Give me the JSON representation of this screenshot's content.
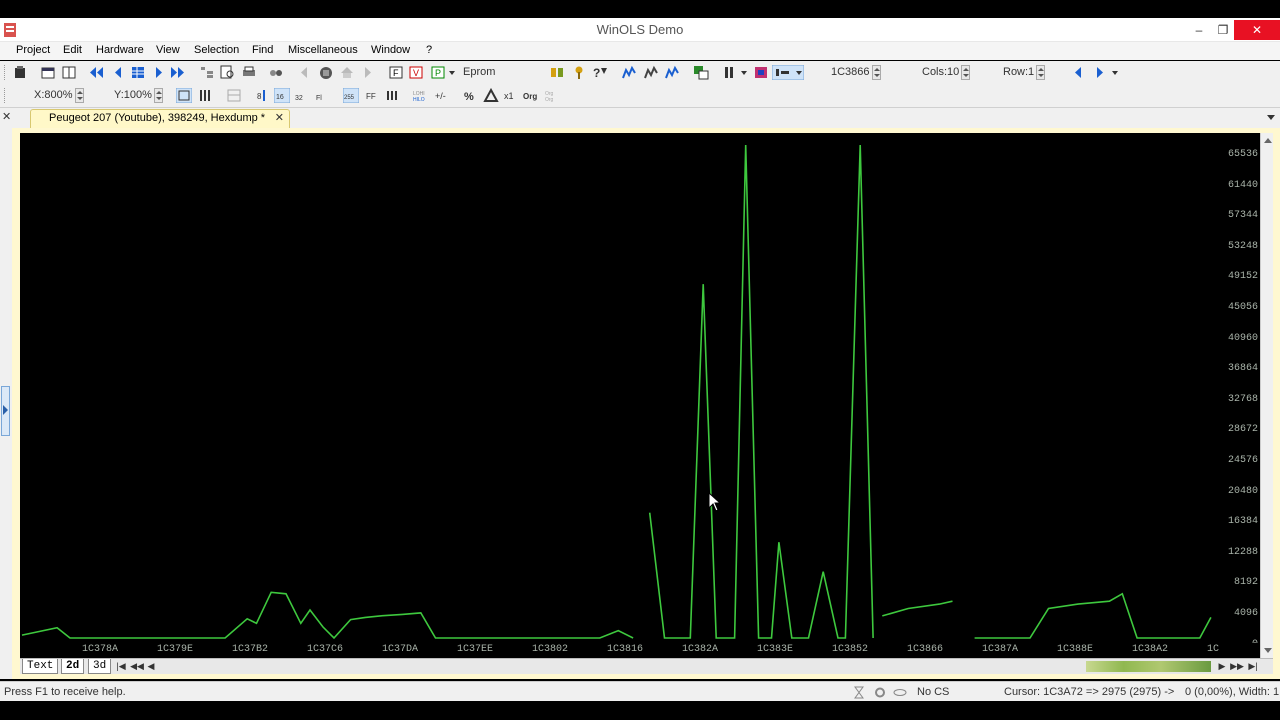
{
  "window": {
    "title": "WinOLS Demo",
    "minimize_glyph": "–",
    "restore_glyph": "❐",
    "close_glyph": "✕"
  },
  "menu": [
    "Project",
    "Edit",
    "Hardware",
    "View",
    "Selection",
    "Find",
    "Miscellaneous",
    "Window",
    "?"
  ],
  "toolbar": {
    "eprom_combo": "Eprom",
    "address": "1C3866",
    "cols": "Cols:10",
    "row": "Row:1",
    "x_zoom": "X:800%",
    "y_zoom": "Y:100%",
    "btn_255": "255",
    "btn_ff": "FF",
    "btn_percent": "%",
    "btn_x1": "x1",
    "btn_org": "Org"
  },
  "tab": {
    "label": "Peugeot 207 (Youtube), 398249, Hexdump *",
    "close_glyph": "✕",
    "left_close_glyph": "✕"
  },
  "chart_data": {
    "type": "line",
    "y_ticks": [
      "65536",
      "61440",
      "57344",
      "53248",
      "49152",
      "45056",
      "40960",
      "36864",
      "32768",
      "28672",
      "24576",
      "20480",
      "16384",
      "12288",
      "8192",
      "4096",
      "0"
    ],
    "x_ticks": [
      "1C378A",
      "1C379E",
      "1C37B2",
      "1C37C6",
      "1C37DA",
      "1C37EE",
      "1C3802",
      "1C3816",
      "1C382A",
      "1C383E",
      "1C3852",
      "1C3866",
      "1C387A",
      "1C388E",
      "1C38A2",
      "1C"
    ],
    "ylim": [
      0,
      65536
    ],
    "grid": false,
    "series_color": "#3ec83e",
    "segments": [
      [
        [
          0,
          400
        ],
        [
          1.9,
          1400
        ],
        [
          2.6,
          0
        ],
        [
          10.2,
          0
        ],
        [
          11.0,
          0
        ],
        [
          12.2,
          2600
        ],
        [
          12.7,
          2000
        ],
        [
          13.5,
          6200
        ],
        [
          14.3,
          6000
        ],
        [
          15.1,
          2000
        ],
        [
          15.6,
          3800
        ],
        [
          16.3,
          1500
        ],
        [
          16.9,
          0
        ],
        [
          17.8,
          2500
        ],
        [
          18.6,
          2800
        ],
        [
          19.4,
          3000
        ],
        [
          20.6,
          3200
        ],
        [
          21.6,
          3400
        ],
        [
          22.4,
          0
        ],
        [
          31.3,
          0
        ],
        [
          32.3,
          1000
        ],
        [
          33.1,
          0
        ]
      ],
      [
        [
          34.0,
          17000
        ],
        [
          34.8,
          0
        ],
        [
          36.2,
          0
        ],
        [
          36.9,
          48000
        ],
        [
          37.6,
          0
        ],
        [
          38.6,
          0
        ],
        [
          39.2,
          77000
        ],
        [
          39.9,
          0
        ],
        [
          40.6,
          0
        ],
        [
          41.0,
          13000
        ],
        [
          41.7,
          0
        ],
        [
          42.6,
          0
        ],
        [
          43.4,
          9000
        ],
        [
          44.2,
          0
        ],
        [
          44.6,
          0
        ],
        [
          45.4,
          77000
        ],
        [
          46.1,
          0
        ]
      ],
      [
        [
          46.6,
          3000
        ],
        [
          48.0,
          4000
        ],
        [
          49.7,
          4600
        ],
        [
          50.4,
          5000
        ]
      ],
      [
        [
          51.6,
          0
        ],
        [
          54.6,
          0
        ],
        [
          55.6,
          4000
        ],
        [
          57.2,
          4600
        ],
        [
          58.9,
          5000
        ],
        [
          59.6,
          6000
        ],
        [
          60.4,
          0
        ],
        [
          63.8,
          0
        ],
        [
          64.4,
          2800
        ]
      ]
    ],
    "x_count": 65
  },
  "bottom_tabs": [
    "Text",
    "2d",
    "3d"
  ],
  "status": {
    "help": "Press F1 to receive help.",
    "cs": "No CS",
    "cursor": "Cursor: 1C3A72 => 2975 (2975) ->",
    "selection": "0 (0,00%), Width: 1"
  }
}
